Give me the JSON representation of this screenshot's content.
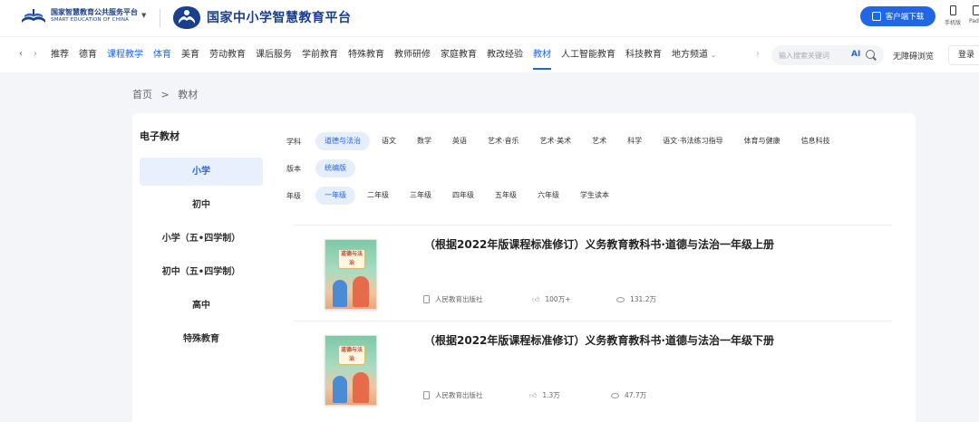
{
  "header": {
    "org_logo_cn": "国家智慧教育公共服务平台",
    "org_logo_en": "SMART EDUCATION OF CHINA",
    "platform_title": "国家中小学智慧教育平台",
    "download_button": "客户端下载",
    "mobile_label": "手机版",
    "pad_label": "Pad"
  },
  "nav": {
    "items": [
      "推荐",
      "德育",
      "课程教学",
      "体育",
      "美育",
      "劳动教育",
      "课后服务",
      "学前教育",
      "特殊教育",
      "教师研修",
      "家庭教育",
      "教改经验",
      "教材",
      "人工智能教育",
      "科技教育",
      "地方频道"
    ],
    "search_placeholder": "输入搜索关键词",
    "ai_label": "AI",
    "accessibility": "无障碍浏览",
    "login": "登录",
    "left_arrow": "‹",
    "right_arrow": "›"
  },
  "breadcrumb": {
    "home": "首页",
    "separator": ">",
    "current": "教材"
  },
  "sidebar": {
    "title": "电子教材",
    "items": [
      "小学",
      "初中",
      "小学（五•四学制）",
      "初中（五•四学制）",
      "高中",
      "特殊教育"
    ]
  },
  "filters": {
    "subject_label": "学科",
    "subjects": [
      "道德与法治",
      "语文",
      "数学",
      "英语",
      "艺术·音乐",
      "艺术·美术",
      "艺术",
      "科学",
      "语文·书法练习指导",
      "体育与健康",
      "信息科技"
    ],
    "edition_label": "版本",
    "editions": [
      "统编版"
    ],
    "grade_label": "年级",
    "grades": [
      "一年级",
      "二年级",
      "三年级",
      "四年级",
      "五年级",
      "六年级",
      "学生读本"
    ]
  },
  "books": [
    {
      "title": "（根据2022年版课程标准修订）义务教育教科书·道德与法治一年级上册",
      "publisher": "人民教育出版社",
      "likes": "100万+",
      "views": "131.2万",
      "cover_text": "道德与法治"
    },
    {
      "title": "（根据2022年版课程标准修订）义务教育教科书·道德与法治一年级下册",
      "publisher": "人民教育出版社",
      "likes": "1.3万",
      "views": "47.7万",
      "cover_text": "道德与法治"
    }
  ],
  "colors": {
    "accent": "#2166e4",
    "brand_dark": "#1a3f8c",
    "active_bg": "#e9f0fd"
  },
  "icons": [
    "book-logo-icon",
    "caret-down-icon",
    "platform-logo-icon",
    "download-icon",
    "mobile-icon",
    "pad-icon",
    "chevron-left-icon",
    "chevron-right-icon",
    "search-icon",
    "publisher-icon",
    "thumb-up-icon",
    "eye-icon"
  ]
}
